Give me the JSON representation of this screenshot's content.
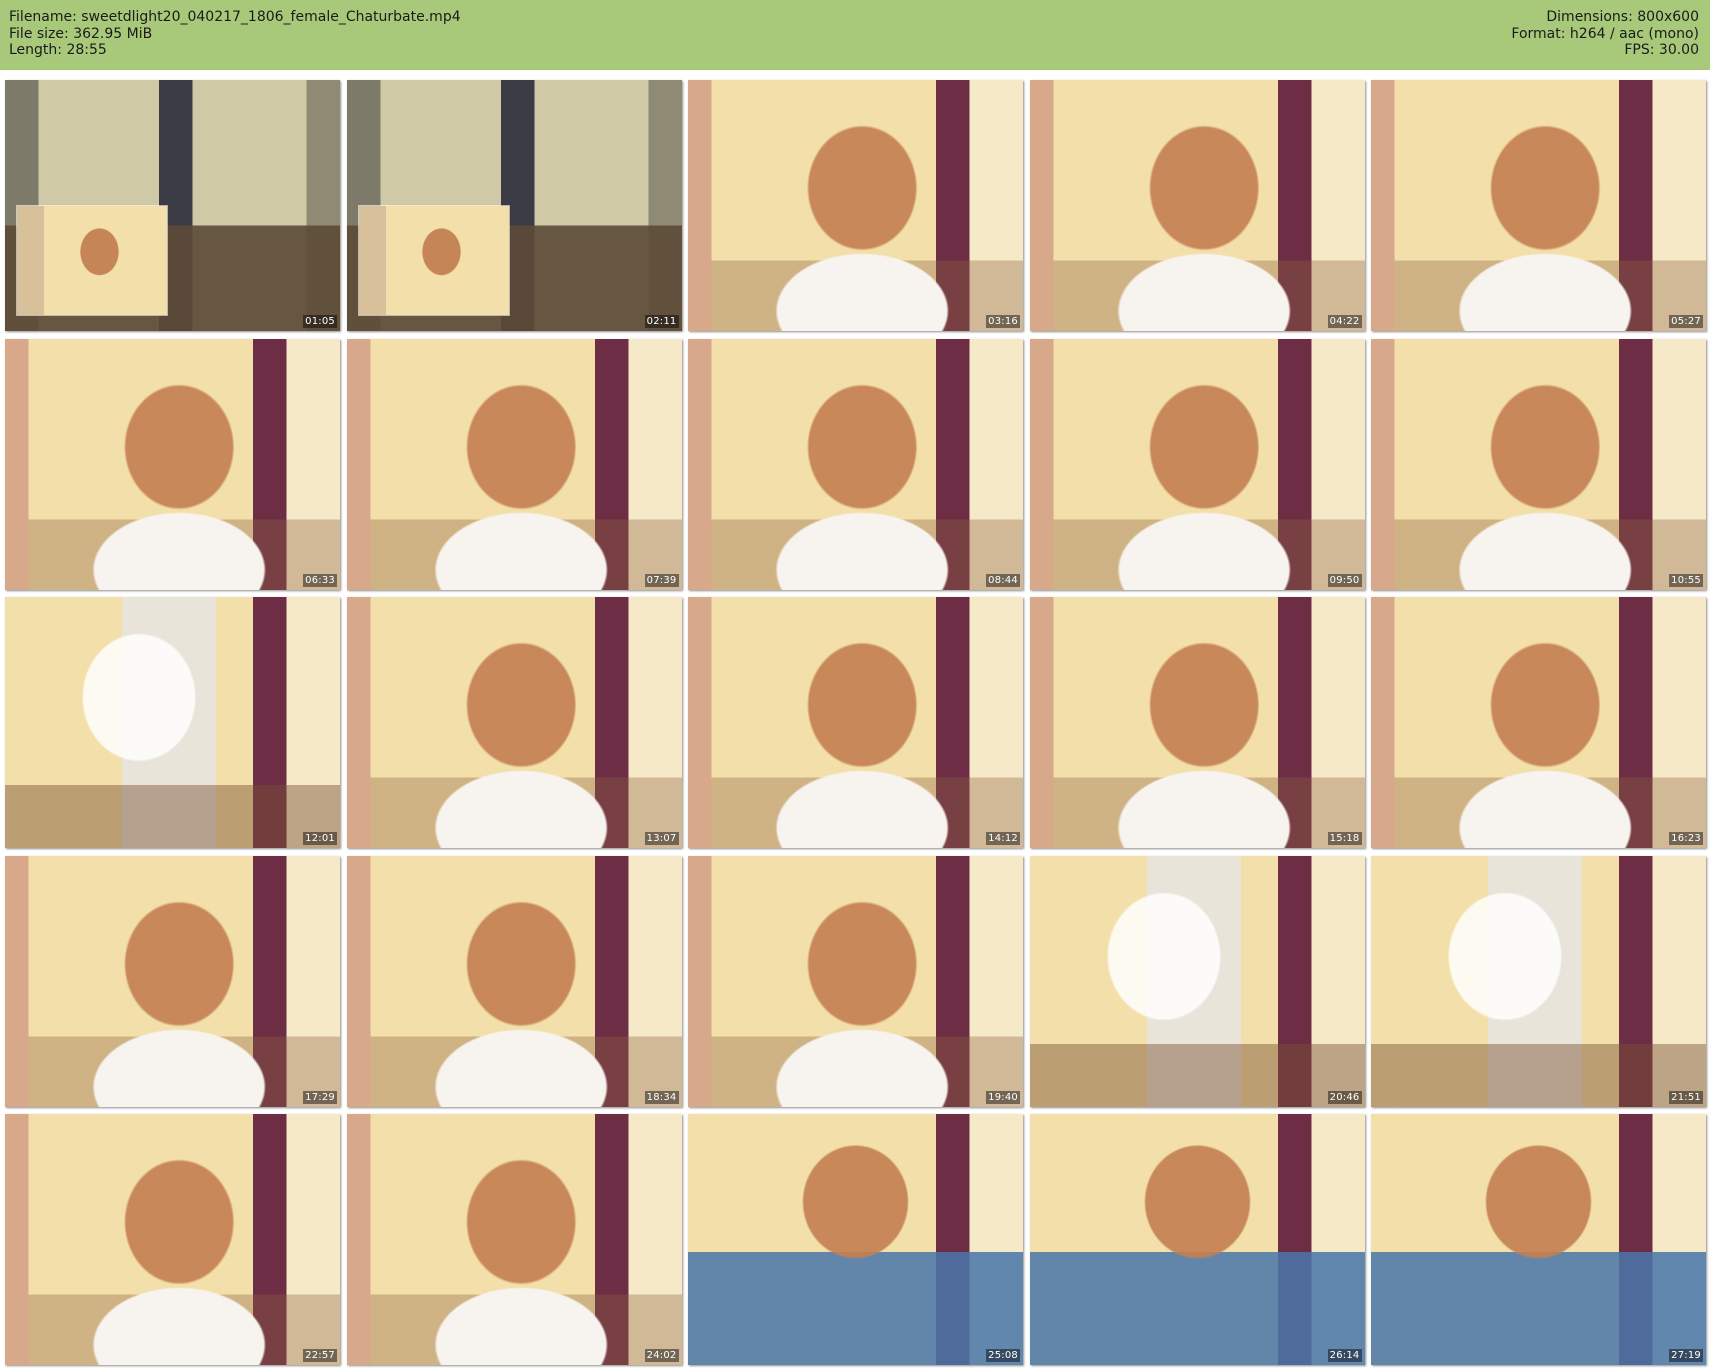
{
  "header": {
    "filename_line": "Filename: sweetdlight20_040217_1806_female_Chaturbate.mp4",
    "filesize_line": "File size: 362.95 MiB",
    "length_line": "Length: 28:55",
    "dimensions_line": "Dimensions: 800x600",
    "format_line": "Format: h264 / aac (mono)",
    "fps_line": "FPS: 30.00"
  },
  "thumbnails": [
    {
      "timestamp": "01:05",
      "scene": "store"
    },
    {
      "timestamp": "02:11",
      "scene": "store"
    },
    {
      "timestamp": "03:16",
      "scene": "woman"
    },
    {
      "timestamp": "04:22",
      "scene": "woman"
    },
    {
      "timestamp": "05:27",
      "scene": "woman"
    },
    {
      "timestamp": "06:33",
      "scene": "woman"
    },
    {
      "timestamp": "07:39",
      "scene": "woman"
    },
    {
      "timestamp": "08:44",
      "scene": "woman"
    },
    {
      "timestamp": "09:50",
      "scene": "woman"
    },
    {
      "timestamp": "10:55",
      "scene": "woman"
    },
    {
      "timestamp": "12:01",
      "scene": "room"
    },
    {
      "timestamp": "13:07",
      "scene": "woman"
    },
    {
      "timestamp": "14:12",
      "scene": "woman"
    },
    {
      "timestamp": "15:18",
      "scene": "woman"
    },
    {
      "timestamp": "16:23",
      "scene": "woman"
    },
    {
      "timestamp": "17:29",
      "scene": "woman"
    },
    {
      "timestamp": "18:34",
      "scene": "woman"
    },
    {
      "timestamp": "19:40",
      "scene": "woman"
    },
    {
      "timestamp": "20:46",
      "scene": "room"
    },
    {
      "timestamp": "21:51",
      "scene": "room"
    },
    {
      "timestamp": "22:57",
      "scene": "woman"
    },
    {
      "timestamp": "24:02",
      "scene": "woman"
    },
    {
      "timestamp": "25:08",
      "scene": "denim"
    },
    {
      "timestamp": "26:14",
      "scene": "denim"
    },
    {
      "timestamp": "27:19",
      "scene": "denim"
    }
  ]
}
